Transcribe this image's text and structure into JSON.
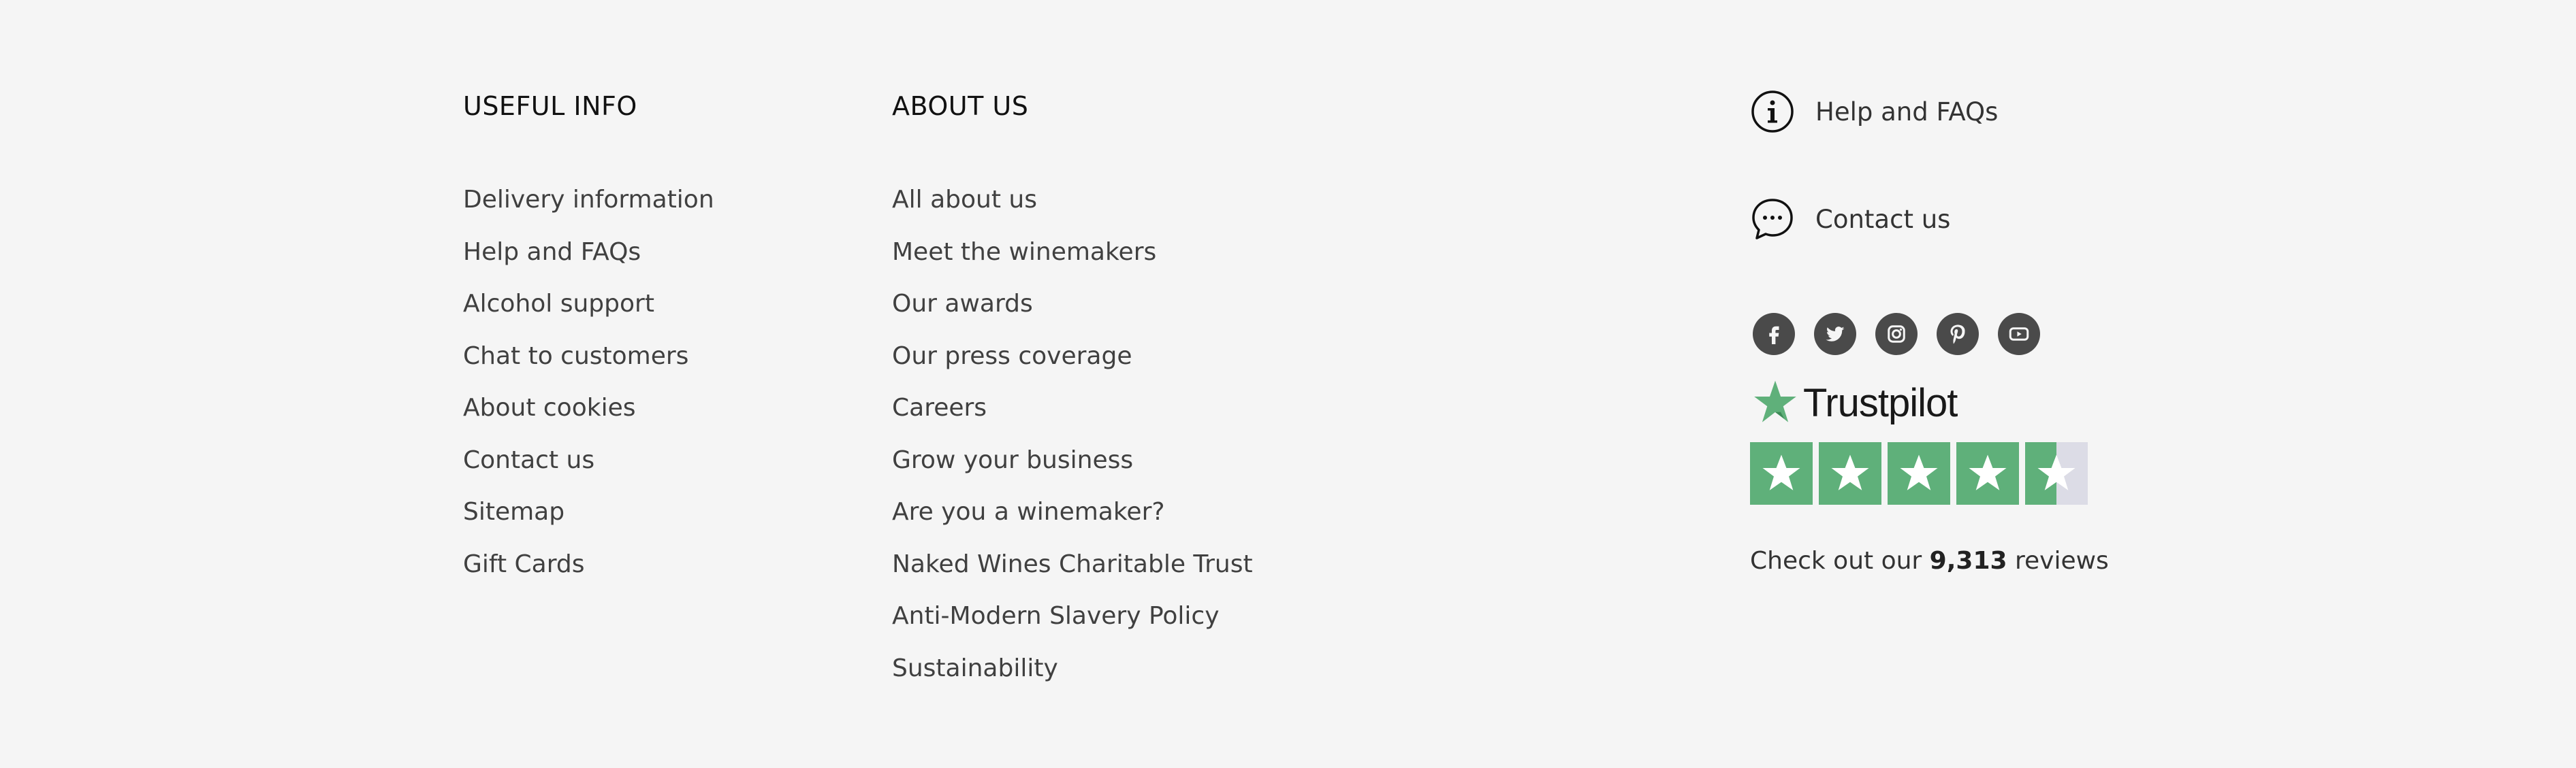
{
  "useful_info": {
    "heading": "USEFUL INFO",
    "links": [
      "Delivery information",
      "Help and FAQs",
      "Alcohol support",
      "Chat to customers",
      "About cookies",
      "Contact us",
      "Sitemap",
      "Gift Cards"
    ]
  },
  "about_us": {
    "heading": "ABOUT US",
    "links": [
      "All about us",
      "Meet the winemakers",
      "Our awards",
      "Our press coverage",
      "Careers",
      "Grow your business",
      "Are you a winemaker?",
      "Naked Wines Charitable Trust",
      "Anti-Modern Slavery Policy",
      "Sustainability"
    ]
  },
  "side": {
    "help_label": "Help and FAQs",
    "help_icon": "info-circle-icon",
    "contact_label": "Contact us",
    "contact_icon": "chat-bubble-icon",
    "social": [
      "facebook-icon",
      "twitter-icon",
      "instagram-icon",
      "pinterest-icon",
      "youtube-icon"
    ]
  },
  "trustpilot": {
    "name": "Trustpilot",
    "rating_stars": 4.5,
    "star_color": "#5fb07a",
    "empty_color": "#dcdce6",
    "reviews_prefix": "Check out our ",
    "reviews_count": "9,313",
    "reviews_suffix": " reviews"
  }
}
